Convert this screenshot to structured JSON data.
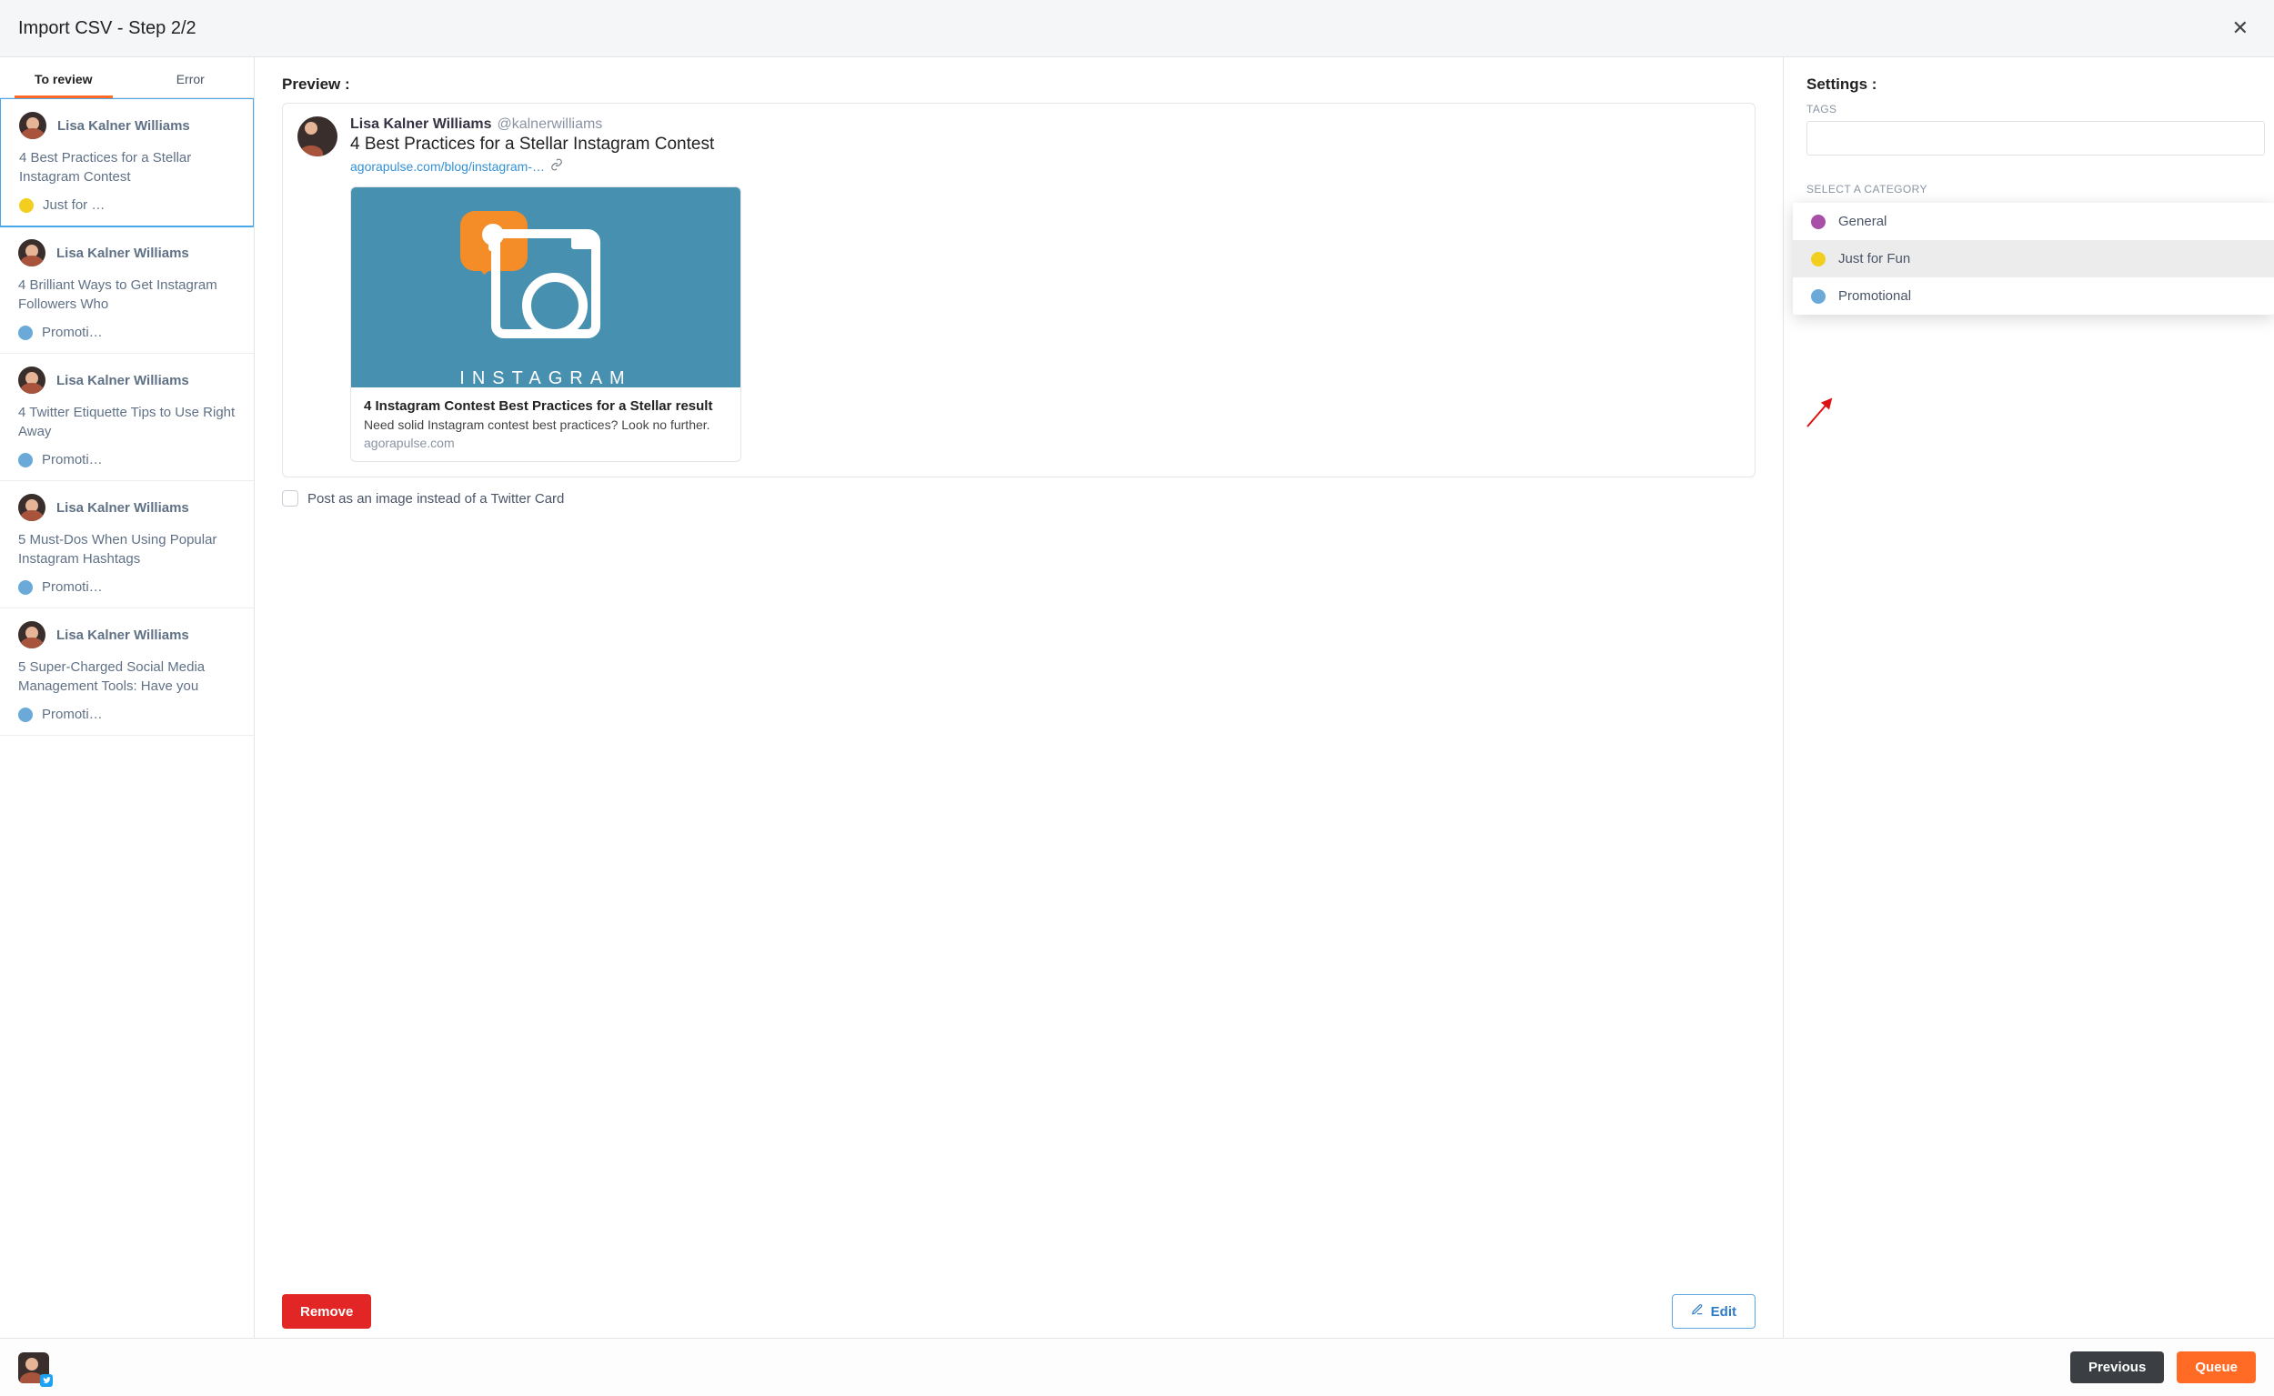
{
  "modal_title": "Import CSV - Step 2/2",
  "tabs": {
    "review": "To review",
    "error": "Error"
  },
  "colors": {
    "general": "#a84fa8",
    "just_for_fun": "#f2cf1e",
    "promotional": "#6aa9d8"
  },
  "posts": [
    {
      "author": "Lisa Kalner Williams",
      "title": "4 Best Practices for a Stellar Instagram Contest",
      "category": "Just for …",
      "cat_color_key": "just_for_fun",
      "selected": true
    },
    {
      "author": "Lisa Kalner Williams",
      "title": "4 Brilliant Ways to Get Instagram Followers Who",
      "category": "Promoti…",
      "cat_color_key": "promotional",
      "selected": false
    },
    {
      "author": "Lisa Kalner Williams",
      "title": "4 Twitter Etiquette Tips to Use Right Away",
      "category": "Promoti…",
      "cat_color_key": "promotional",
      "selected": false
    },
    {
      "author": "Lisa Kalner Williams",
      "title": "5 Must-Dos When Using Popular Instagram Hashtags",
      "category": "Promoti…",
      "cat_color_key": "promotional",
      "selected": false
    },
    {
      "author": "Lisa Kalner Williams",
      "title": "5 Super-Charged Social Media Management Tools: Have you",
      "category": "Promoti…",
      "cat_color_key": "promotional",
      "selected": false
    }
  ],
  "preview": {
    "heading": "Preview :",
    "author_name": "Lisa Kalner Williams",
    "author_handle": "@kalnerwilliams",
    "text": "4 Best Practices for a Stellar Instagram Contest",
    "link": "agorapulse.com/blog/instagram-…",
    "embed_brand": "INSTAGRAM",
    "embed_title": "4 Instagram Contest Best Practices for a Stellar result",
    "embed_desc": "Need solid Instagram contest best practices? Look no further.",
    "embed_domain": "agorapulse.com",
    "checkbox_label": "Post as an image instead of a Twitter Card",
    "remove": "Remove",
    "edit": "Edit"
  },
  "settings": {
    "heading": "Settings :",
    "tags_label": "TAGS",
    "select_label": "SELECT A CATEGORY",
    "options": [
      {
        "label": "General",
        "color_key": "general",
        "hover": false
      },
      {
        "label": "Just for Fun",
        "color_key": "just_for_fun",
        "hover": true
      },
      {
        "label": "Promotional",
        "color_key": "promotional",
        "hover": false
      }
    ]
  },
  "footer": {
    "previous": "Previous",
    "queue": "Queue"
  }
}
